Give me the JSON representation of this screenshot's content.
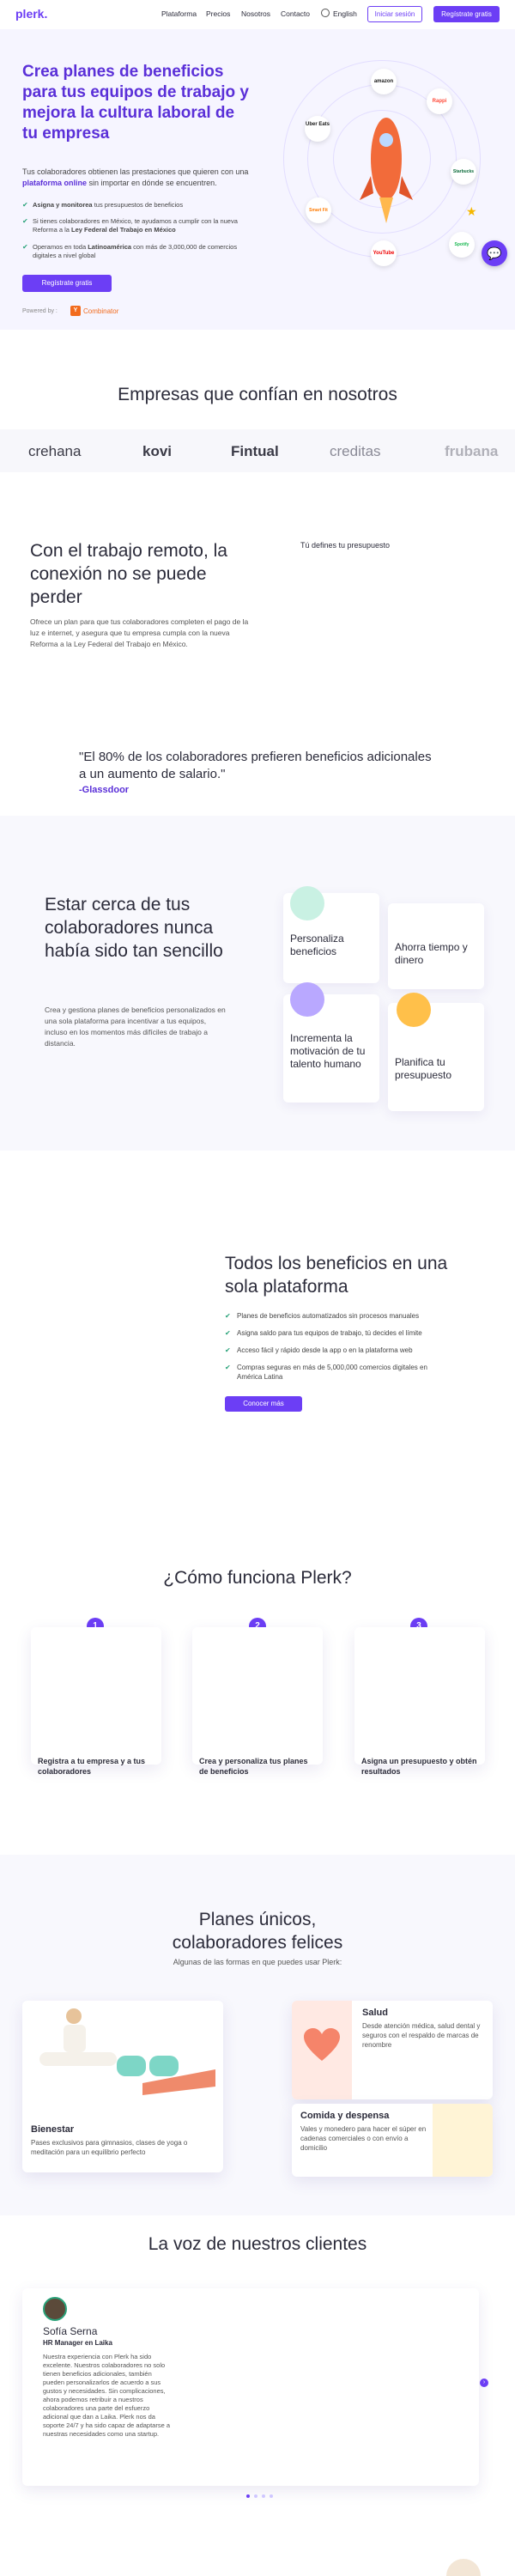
{
  "nav": {
    "logo": "plerk.",
    "links": [
      "Plataforma",
      "Precios",
      "Nosotros",
      "Contacto"
    ],
    "language": "English",
    "login": "Iniciar sesión",
    "signup": "Regístrate gratis"
  },
  "hero": {
    "title": "Crea planes de beneficios para tus equipos de trabajo y mejora la cultura laboral de tu empresa",
    "subtitle_pre": "Tus colaboradores obtienen las prestaciones que quieren con una",
    "subtitle_bold": "plataforma online",
    "subtitle_post": "sin importar en dónde se encuentren.",
    "bullets": [
      {
        "bold": "Asigna y monitorea",
        "text": " tus presupuestos de beneficios"
      },
      {
        "bold": "",
        "text": "Si tienes colaboradores en México, te ayudamos a cumplir con la nueva Reforma a la ",
        "bold2": "Ley Federal del Trabajo en México"
      },
      {
        "bold": "",
        "text": "Operamos en toda ",
        "bold2": "Latinoamérica",
        "tail": " con más de 3,000,000 de comercios digitales a nivel global"
      }
    ],
    "cta": "Regístrate gratis",
    "powered_by": "Powered by :",
    "powered_brand": "Combinator",
    "powered_badge": "Y",
    "brands": [
      "amazon",
      "Rappi",
      "Uber Eats",
      "Starbucks",
      "Smart Fit",
      "YouTube",
      "Spotify"
    ]
  },
  "trust": {
    "title": "Empresas que confían en nosotros",
    "logos": [
      "crehana",
      "kovi",
      "Fintual",
      "creditas",
      "frubana"
    ]
  },
  "remote": {
    "title": "Con el trabajo remoto, la conexión no se puede perder",
    "body": "Ofrece un plan para que tus colaboradores completen el pago de la luz e internet, y asegura que tu empresa cumpla con la nueva Reforma a la Ley Federal del Trabajo en México.",
    "aside": "Tú defines tu presupuesto"
  },
  "quote": {
    "text": "\"El 80% de los colaboradores prefieren beneficios adicionales a un aumento de salario.\"",
    "source": "-Glassdoor"
  },
  "cerca": {
    "title": "Estar cerca de tus colaboradores nunca había sido tan sencillo",
    "body": "Crea y gestiona planes de beneficios personalizados en una sola plataforma para incentivar a tus equipos, incluso en los momentos más difíciles de trabajo a distancia.",
    "cards": [
      "Personaliza beneficios",
      "Ahorra tiempo y dinero",
      "Incrementa la motivación de tu talento humano",
      "Planifica tu presupuesto"
    ]
  },
  "platform": {
    "title": "Todos los beneficios en una sola plataforma",
    "bullets": [
      "Planes de beneficios automatizados sin procesos manuales",
      "Asigna saldo para tus equipos de trabajo, tú decides el límite",
      "Acceso fácil y rápido desde la app o en la plataforma web",
      "Compras seguras en más de 5,000,000 comercios digitales en América Latina"
    ],
    "cta": "Conocer más"
  },
  "how": {
    "title": "¿Cómo funciona Plerk?",
    "steps": [
      {
        "num": "1",
        "label": "Registra a tu empresa y a tus colaboradores"
      },
      {
        "num": "2",
        "label": "Crea y personaliza tus planes de beneficios"
      },
      {
        "num": "3",
        "label": "Asigna un presupuesto y obtén resultados"
      }
    ]
  },
  "plans": {
    "title": "Planes únicos, colaboradores felices",
    "subtitle": "Algunas de las formas en que puedes usar Plerk:",
    "items": [
      {
        "title": "Bienestar",
        "desc": "Pases exclusivos para gimnasios, clases de yoga o meditación para un equilibrio perfecto"
      },
      {
        "title": "Salud",
        "desc": "Desde atención médica, salud dental y seguros con el respaldo de marcas de renombre"
      },
      {
        "title": "Comida y despensa",
        "desc": "Vales y monedero para hacer el súper en cadenas comerciales o con envío a domicilio"
      }
    ]
  },
  "testimonials": {
    "title": "La voz de nuestros clientes",
    "name": "Sofía Serna",
    "role": "HR Manager en Laika",
    "text": "Nuestra experiencia con Plerk ha sido excelente. Nuestros colaboradores no solo tienen beneficios adicionales, también pueden personalizarlos de acuerdo a sus gustos y necesidades. Sin complicaciones, ahora podemos retribuir a nuestros colaboradores una parte del esfuerzo adicional que dan a Laika. Plerk nos da soporte 24/7 y ha sido capaz de adaptarse a nuestras necesidades como una startup."
  },
  "colors": {
    "brand": "#6c3ef5",
    "brand_dark": "#5a2fd8",
    "check": "#2aa37a"
  }
}
